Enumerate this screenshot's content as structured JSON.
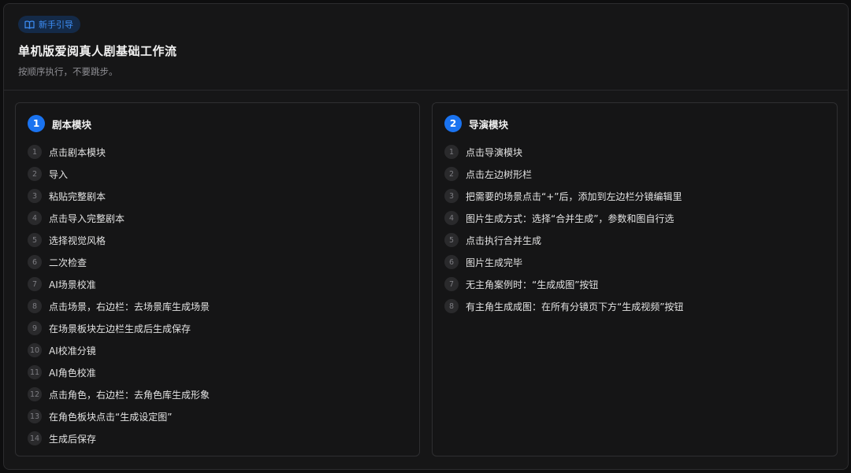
{
  "header": {
    "tag_label": "新手引导",
    "title": "单机版爱阅真人剧基础工作流",
    "subtitle": "按顺序执行，不要跳步。"
  },
  "modules": [
    {
      "number": "1",
      "title": "剧本模块",
      "steps": [
        {
          "num": "1",
          "text": "点击剧本模块"
        },
        {
          "num": "2",
          "text": "导入"
        },
        {
          "num": "3",
          "text": "粘贴完整剧本"
        },
        {
          "num": "4",
          "text": "点击导入完整剧本"
        },
        {
          "num": "5",
          "text": "选择视觉风格"
        },
        {
          "num": "6",
          "text": "二次检查"
        },
        {
          "num": "7",
          "text": "AI场景校准"
        },
        {
          "num": "8",
          "text": "点击场景，右边栏：去场景库生成场景"
        },
        {
          "num": "9",
          "text": "在场景板块左边栏生成后生成保存"
        },
        {
          "num": "10",
          "text": "AI校准分镜"
        },
        {
          "num": "11",
          "text": "AI角色校准"
        },
        {
          "num": "12",
          "text": "点击角色，右边栏：去角色库生成形象"
        },
        {
          "num": "13",
          "text": "在角色板块点击“生成设定图”"
        },
        {
          "num": "14",
          "text": "生成后保存"
        }
      ]
    },
    {
      "number": "2",
      "title": "导演模块",
      "steps": [
        {
          "num": "1",
          "text": "点击导演模块"
        },
        {
          "num": "2",
          "text": "点击左边树形栏"
        },
        {
          "num": "3",
          "text": "把需要的场景点击“+”后，添加到左边栏分镜编辑里"
        },
        {
          "num": "4",
          "text": "图片生成方式：选择“合并生成”，参数和图自行选"
        },
        {
          "num": "5",
          "text": "点击执行合并生成"
        },
        {
          "num": "6",
          "text": "图片生成完毕"
        },
        {
          "num": "7",
          "text": "无主角案例时：“生成成图”按钮"
        },
        {
          "num": "8",
          "text": "有主角生成成图：在所有分镜页下方“生成视频”按钮"
        }
      ]
    }
  ]
}
